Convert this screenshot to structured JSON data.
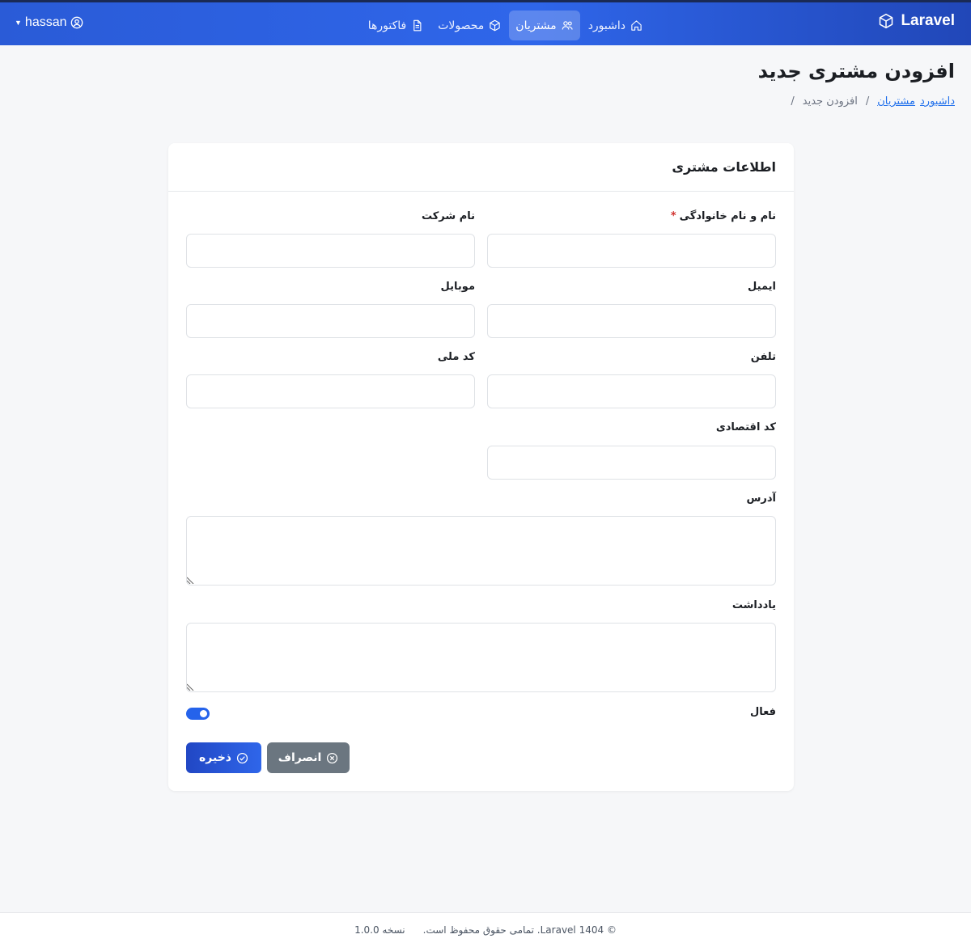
{
  "nav": {
    "brand": "Laravel",
    "items": [
      {
        "label": "داشبورد",
        "icon": "home-icon"
      },
      {
        "label": "مشتریان",
        "icon": "users-icon"
      },
      {
        "label": "محصولات",
        "icon": "box-icon"
      },
      {
        "label": "فاکتورها",
        "icon": "file-icon"
      }
    ],
    "active_item": "مشتریان",
    "user": "hassan",
    "accent": "#2f66ea"
  },
  "page": {
    "title": "افزودن مشتری جدید",
    "breadcrumb": {
      "link_1": "داشبورد",
      "link_2": "مشتریان",
      "current": "افزودن جدید",
      "separator": "/"
    }
  },
  "form": {
    "card_title": "اطلاعات مشتری",
    "required_mark": "*",
    "fields": {
      "full_name": {
        "label": "نام و نام خانوادگی",
        "value": ""
      },
      "company": {
        "label": "نام شرکت",
        "value": ""
      },
      "email": {
        "label": "ایمیل",
        "value": ""
      },
      "mobile": {
        "label": "موبایل",
        "value": ""
      },
      "phone": {
        "label": "تلفن",
        "value": ""
      },
      "national_code": {
        "label": "کد ملی",
        "value": ""
      },
      "economic_code": {
        "label": "کد اقتصادی",
        "value": ""
      },
      "address": {
        "label": "آدرس",
        "value": ""
      },
      "note": {
        "label": "یادداشت",
        "value": ""
      }
    },
    "active": {
      "label": "فعال",
      "checked": true
    },
    "buttons": {
      "save": "ذخیره",
      "cancel": "انصراف"
    }
  },
  "footer": {
    "copyright": "© Laravel 1404. تمامی حقوق محفوظ است.",
    "version": "نسخه 1.0.0"
  }
}
